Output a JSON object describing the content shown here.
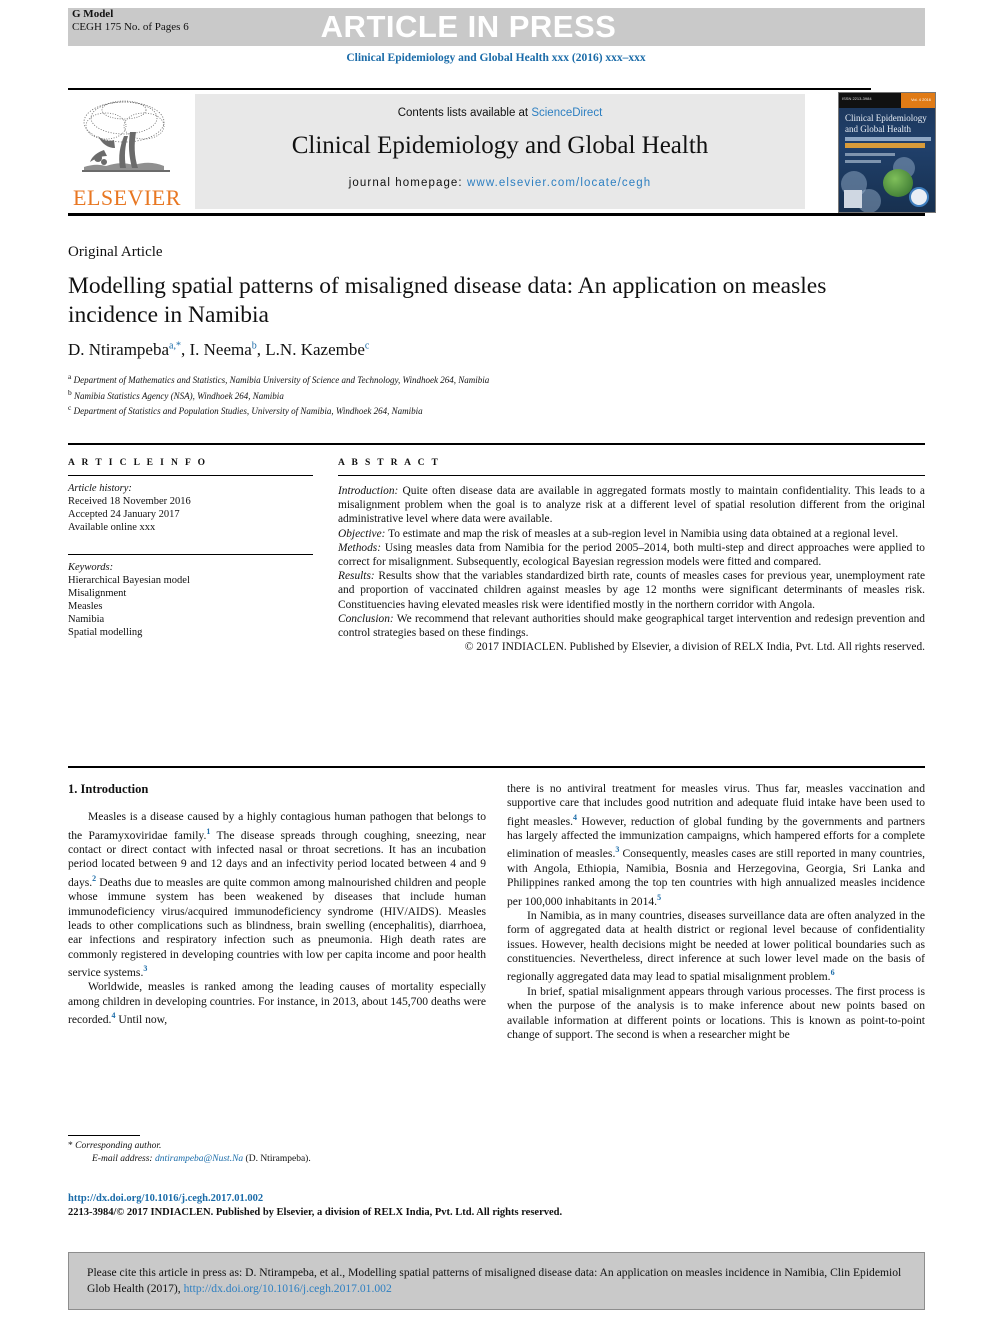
{
  "header": {
    "g_model_label": "G Model",
    "g_model_code": "CEGH 175 No. of Pages 6",
    "article_in_press": "ARTICLE IN PRESS",
    "running_head": "Clinical Epidemiology and Global Health xxx (2016) xxx–xxx"
  },
  "masthead": {
    "contents_prefix": "Contents lists available at ",
    "sciencedirect": "ScienceDirect",
    "journal_title": "Clinical Epidemiology and Global Health",
    "homepage_prefix": "journal homepage: ",
    "homepage_url": "www.elsevier.com/locate/cegh",
    "publisher": "ELSEVIER",
    "cover_title": "Clinical Epidemiology and Global Health",
    "cover_tiny_left": "ISSN 2213-3984",
    "cover_tiny_right": "Vol. 4 2016"
  },
  "article": {
    "type": "Original Article",
    "title": "Modelling spatial patterns of misaligned disease data: An application on measles incidence in Namibia",
    "authors_html": "D. Ntirampeba<sup>a,*</sup>, I. Neema<sup>b</sup>, L.N. Kazembe<sup>c</sup>",
    "affiliations": [
      "Department of Mathematics and Statistics, Namibia University of Science and Technology, Windhoek 264, Namibia",
      "Namibia Statistics Agency (NSA), Windhoek 264, Namibia",
      "Department of Statistics and Population Studies, University of Namibia, Windhoek 264, Namibia"
    ],
    "affiliation_markers": [
      "a",
      "b",
      "c"
    ]
  },
  "info": {
    "heading": "A R T I C L E   I N F O",
    "history_label": "Article history:",
    "history": [
      "Received 18 November 2016",
      "Accepted 24 January 2017",
      "Available online xxx"
    ],
    "keywords_label": "Keywords:",
    "keywords": [
      "Hierarchical Bayesian model",
      "Misalignment",
      "Measles",
      "Namibia",
      "Spatial modelling"
    ]
  },
  "abstract": {
    "heading": "A B S T R A C T",
    "sections": [
      {
        "label": "Introduction:",
        "text": " Quite often disease data are available in aggregated formats mostly to maintain confidentiality. This leads to a misalignment problem when the goal is to analyze risk at a different level of spatial resolution different from the original administrative level where data were available."
      },
      {
        "label": "Objective:",
        "text": " To estimate and map the risk of measles at a sub-region level in Namibia using data obtained at a regional level."
      },
      {
        "label": "Methods:",
        "text": " Using measles data from Namibia for the period 2005–2014, both multi-step and direct approaches were applied to correct for misalignment. Subsequently, ecological Bayesian regression models were fitted and compared."
      },
      {
        "label": "Results:",
        "text": " Results show that the variables standardized birth rate, counts of measles cases for previous year, unemployment rate and proportion of vaccinated children against measles by age 12 months were significant determinants of measles risk. Constituencies having elevated measles risk were identified mostly in the northern corridor with Angola."
      },
      {
        "label": "Conclusion:",
        "text": " We recommend that relevant authorities should make geographical target intervention and redesign prevention and control strategies based on these findings."
      }
    ],
    "copyright": "© 2017 INDIACLEN. Published by Elsevier, a division of RELX India, Pvt. Ltd. All rights reserved."
  },
  "body": {
    "section_heading": "1. Introduction",
    "left_paragraphs": [
      "Measles is a disease caused by a highly contagious human pathogen that belongs to the Paramyxoviridae family.<sup>1</sup> The disease spreads through coughing, sneezing, near contact or direct contact with infected nasal or throat secretions. It has an incubation period located between 9 and 12 days and an infectivity period located between 4 and 9 days.<sup>2</sup> Deaths due to measles are quite common among malnourished children and people whose immune system has been weakened by diseases that include human immunodeficiency virus/acquired immunodeficiency syndrome (HIV/AIDS). Measles leads to other complications such as blindness, brain swelling (encephalitis), diarrhoea, ear infections and respiratory infection such as pneumonia. High death rates are commonly registered in developing countries with low per capita income and poor health service systems.<sup>3</sup>",
      "Worldwide, measles is ranked among the leading causes of mortality especially among children in developing countries. For instance, in 2013, about 145,700 deaths were recorded.<sup>4</sup> Until now,"
    ],
    "right_paragraphs": [
      "there is no antiviral treatment for measles virus. Thus far, measles vaccination and supportive care that includes good nutrition and adequate fluid intake have been used to fight measles.<sup>4</sup> However, reduction of global funding by the governments and partners has largely affected the immunization campaigns, which hampered efforts for a complete elimination of measles.<sup>3</sup> Consequently, measles cases are still reported in many countries, with Angola, Ethiopia, Namibia, Bosnia and Herzegovina, Georgia, Sri Lanka and Philippines ranked among the top ten countries with high annualized measles incidence per 100,000 inhabitants in 2014.<sup>5</sup>",
      "In Namibia, as in many countries, diseases surveillance data are often analyzed in the form of aggregated data at health district or regional level because of confidentiality issues. However, health decisions might be needed at lower political boundaries such as constituencies. Nevertheless, direct inference at such lower level made on the basis of regionally aggregated data may lead to spatial misalignment problem.<sup>6</sup>",
      "In brief, spatial misalignment appears through various processes. The first process is when the purpose of the analysis is to make inference about new points based on available information at different points or locations. This is known as point-to-point change of support. The second is when a researcher might be"
    ]
  },
  "footer": {
    "corresponding_marker": "*",
    "corresponding_label": "Corresponding author.",
    "email_label": "E-mail address:",
    "email": "dntirampeba@Nust.Na",
    "email_owner": "(D. Ntirampeba).",
    "doi_url": "http://dx.doi.org/10.1016/j.cegh.2017.01.002",
    "issn_line": "2213-3984/© 2017 INDIACLEN. Published by Elsevier, a division of RELX India, Pvt. Ltd. All rights reserved."
  },
  "cite_box": {
    "text_before_link": "Please cite this article in press as: D. Ntirampeba, et al., Modelling spatial patterns of misaligned disease data: An application on measles incidence in Namibia, Clin Epidemiol Glob Health (2017), ",
    "link": "http://dx.doi.org/10.1016/j.cegh.2017.01.002"
  },
  "colors": {
    "link_blue": "#2d7fc1",
    "header_blue": "#1a6ba8",
    "gray_bar": "#c9c9c9",
    "masthead_gray": "#e8e8e8",
    "elsevier_orange": "#e87722"
  }
}
